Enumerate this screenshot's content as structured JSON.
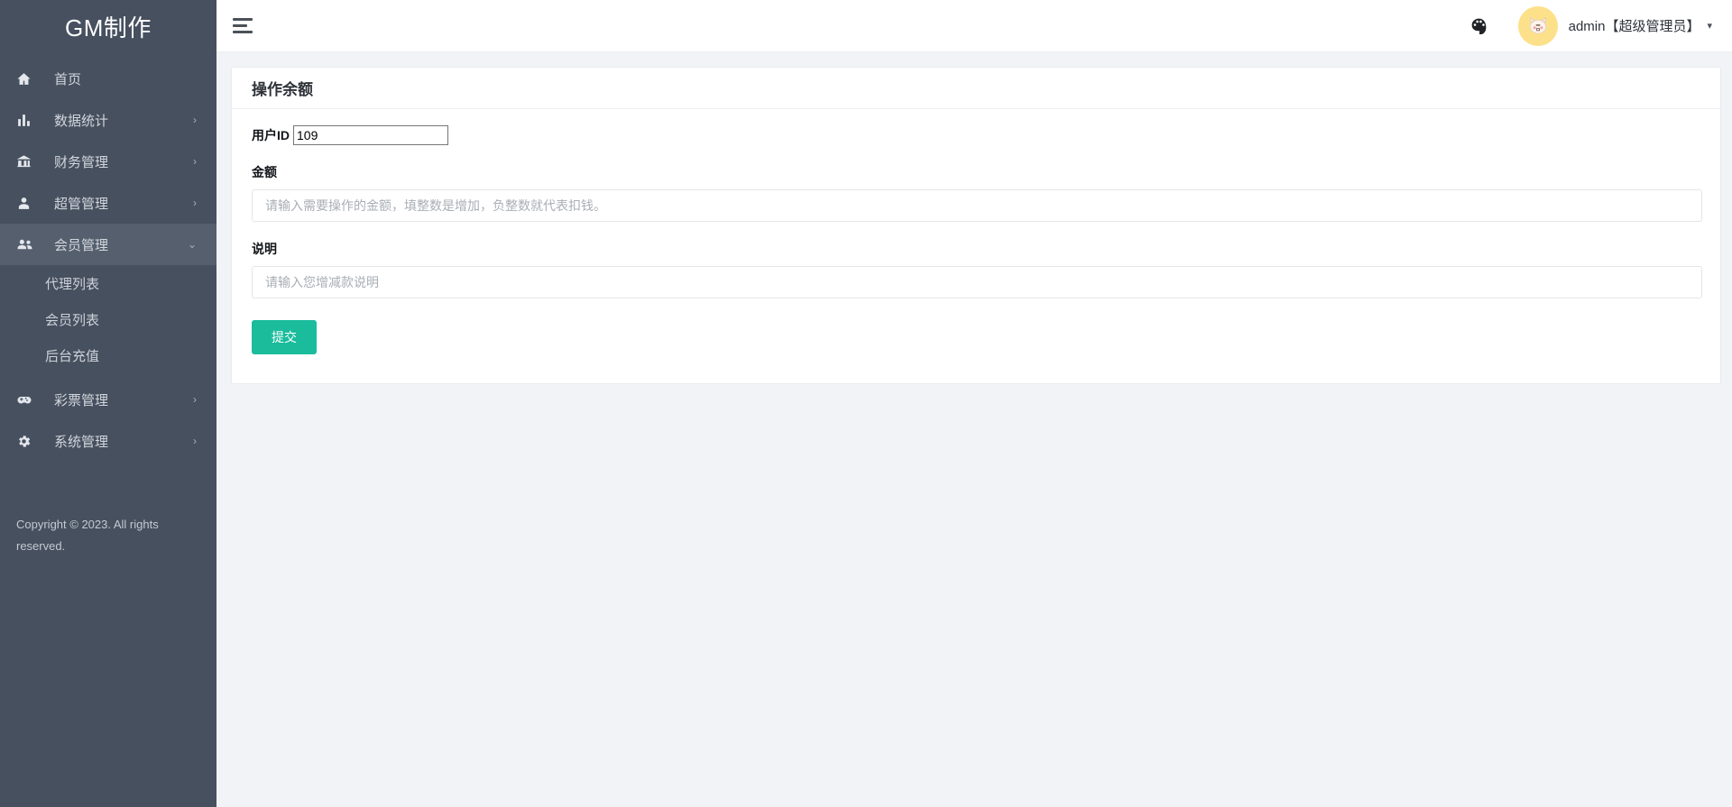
{
  "sidebar": {
    "brand": "GM制作",
    "items": [
      {
        "label": "首页",
        "icon": "home-icon",
        "caret": false,
        "active": false
      },
      {
        "label": "数据统计",
        "icon": "bar-chart-icon",
        "caret": true,
        "active": false
      },
      {
        "label": "财务管理",
        "icon": "bank-icon",
        "caret": true,
        "active": false
      },
      {
        "label": "超管管理",
        "icon": "user-icon",
        "caret": true,
        "active": false
      },
      {
        "label": "会员管理",
        "icon": "users-icon",
        "caret": true,
        "active": true
      }
    ],
    "subitems": [
      {
        "label": "代理列表"
      },
      {
        "label": "会员列表"
      },
      {
        "label": "后台充值"
      }
    ],
    "items_after": [
      {
        "label": "彩票管理",
        "icon": "gamepad-icon",
        "caret": true,
        "active": false
      },
      {
        "label": "系统管理",
        "icon": "gear-icon",
        "caret": true,
        "active": false
      }
    ],
    "copyright": "Copyright © 2023. All rights reserved.",
    "caret_right": "›",
    "caret_down": "⌄"
  },
  "header": {
    "menu_toggle": "hamburger-icon",
    "palette_icon": "palette-icon",
    "avatar": "cat-avatar",
    "user_name": "admin【超级管理员】",
    "user_caret": "▾"
  },
  "card": {
    "title": "操作余额",
    "user_id": {
      "label": "用户ID",
      "value": "109"
    },
    "amount": {
      "label": "金额",
      "value": "",
      "placeholder": "请输入需要操作的金额，填整数是增加，负整数就代表扣钱。"
    },
    "description": {
      "label": "说明",
      "value": "",
      "placeholder": "请输入您增减款说明"
    },
    "submit_label": "提交"
  },
  "colors": {
    "sidebar_bg": "#46505f",
    "sidebar_active": "#555f6d",
    "accent": "#1abc9c",
    "content_bg": "#f1f3f6",
    "avatar_bg": "#fde08a"
  }
}
